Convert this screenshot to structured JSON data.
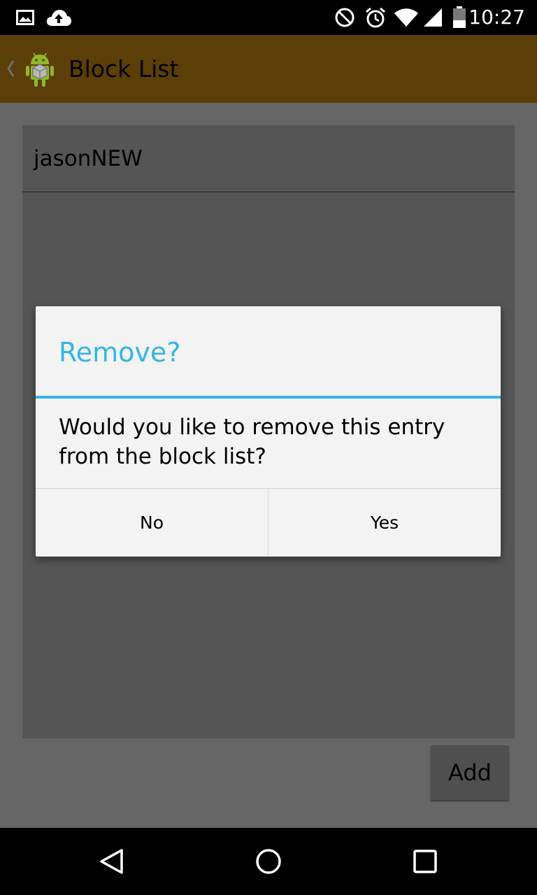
{
  "status_bar": {
    "time": "10:27",
    "icons": [
      "image-icon",
      "cloud-upload-icon",
      "do-not-disturb-icon",
      "alarm-icon",
      "wifi-icon",
      "cell-signal-icon",
      "battery-icon"
    ]
  },
  "action_bar": {
    "title": "Block List",
    "background": "#5c3e08",
    "icons": [
      "back-chevron-icon",
      "android-app-icon"
    ]
  },
  "block_list": {
    "items": [
      {
        "label": "jasonNEW"
      }
    ]
  },
  "add_button": {
    "label": "Add"
  },
  "dialog": {
    "title": "Remove?",
    "message": "Would you like to remove this entry from the block list?",
    "accent": "#33b5e5",
    "buttons": {
      "negative": "No",
      "positive": "Yes"
    }
  },
  "nav_bar": {
    "icons": [
      "back-triangle-icon",
      "home-circle-icon",
      "recents-square-icon"
    ]
  }
}
